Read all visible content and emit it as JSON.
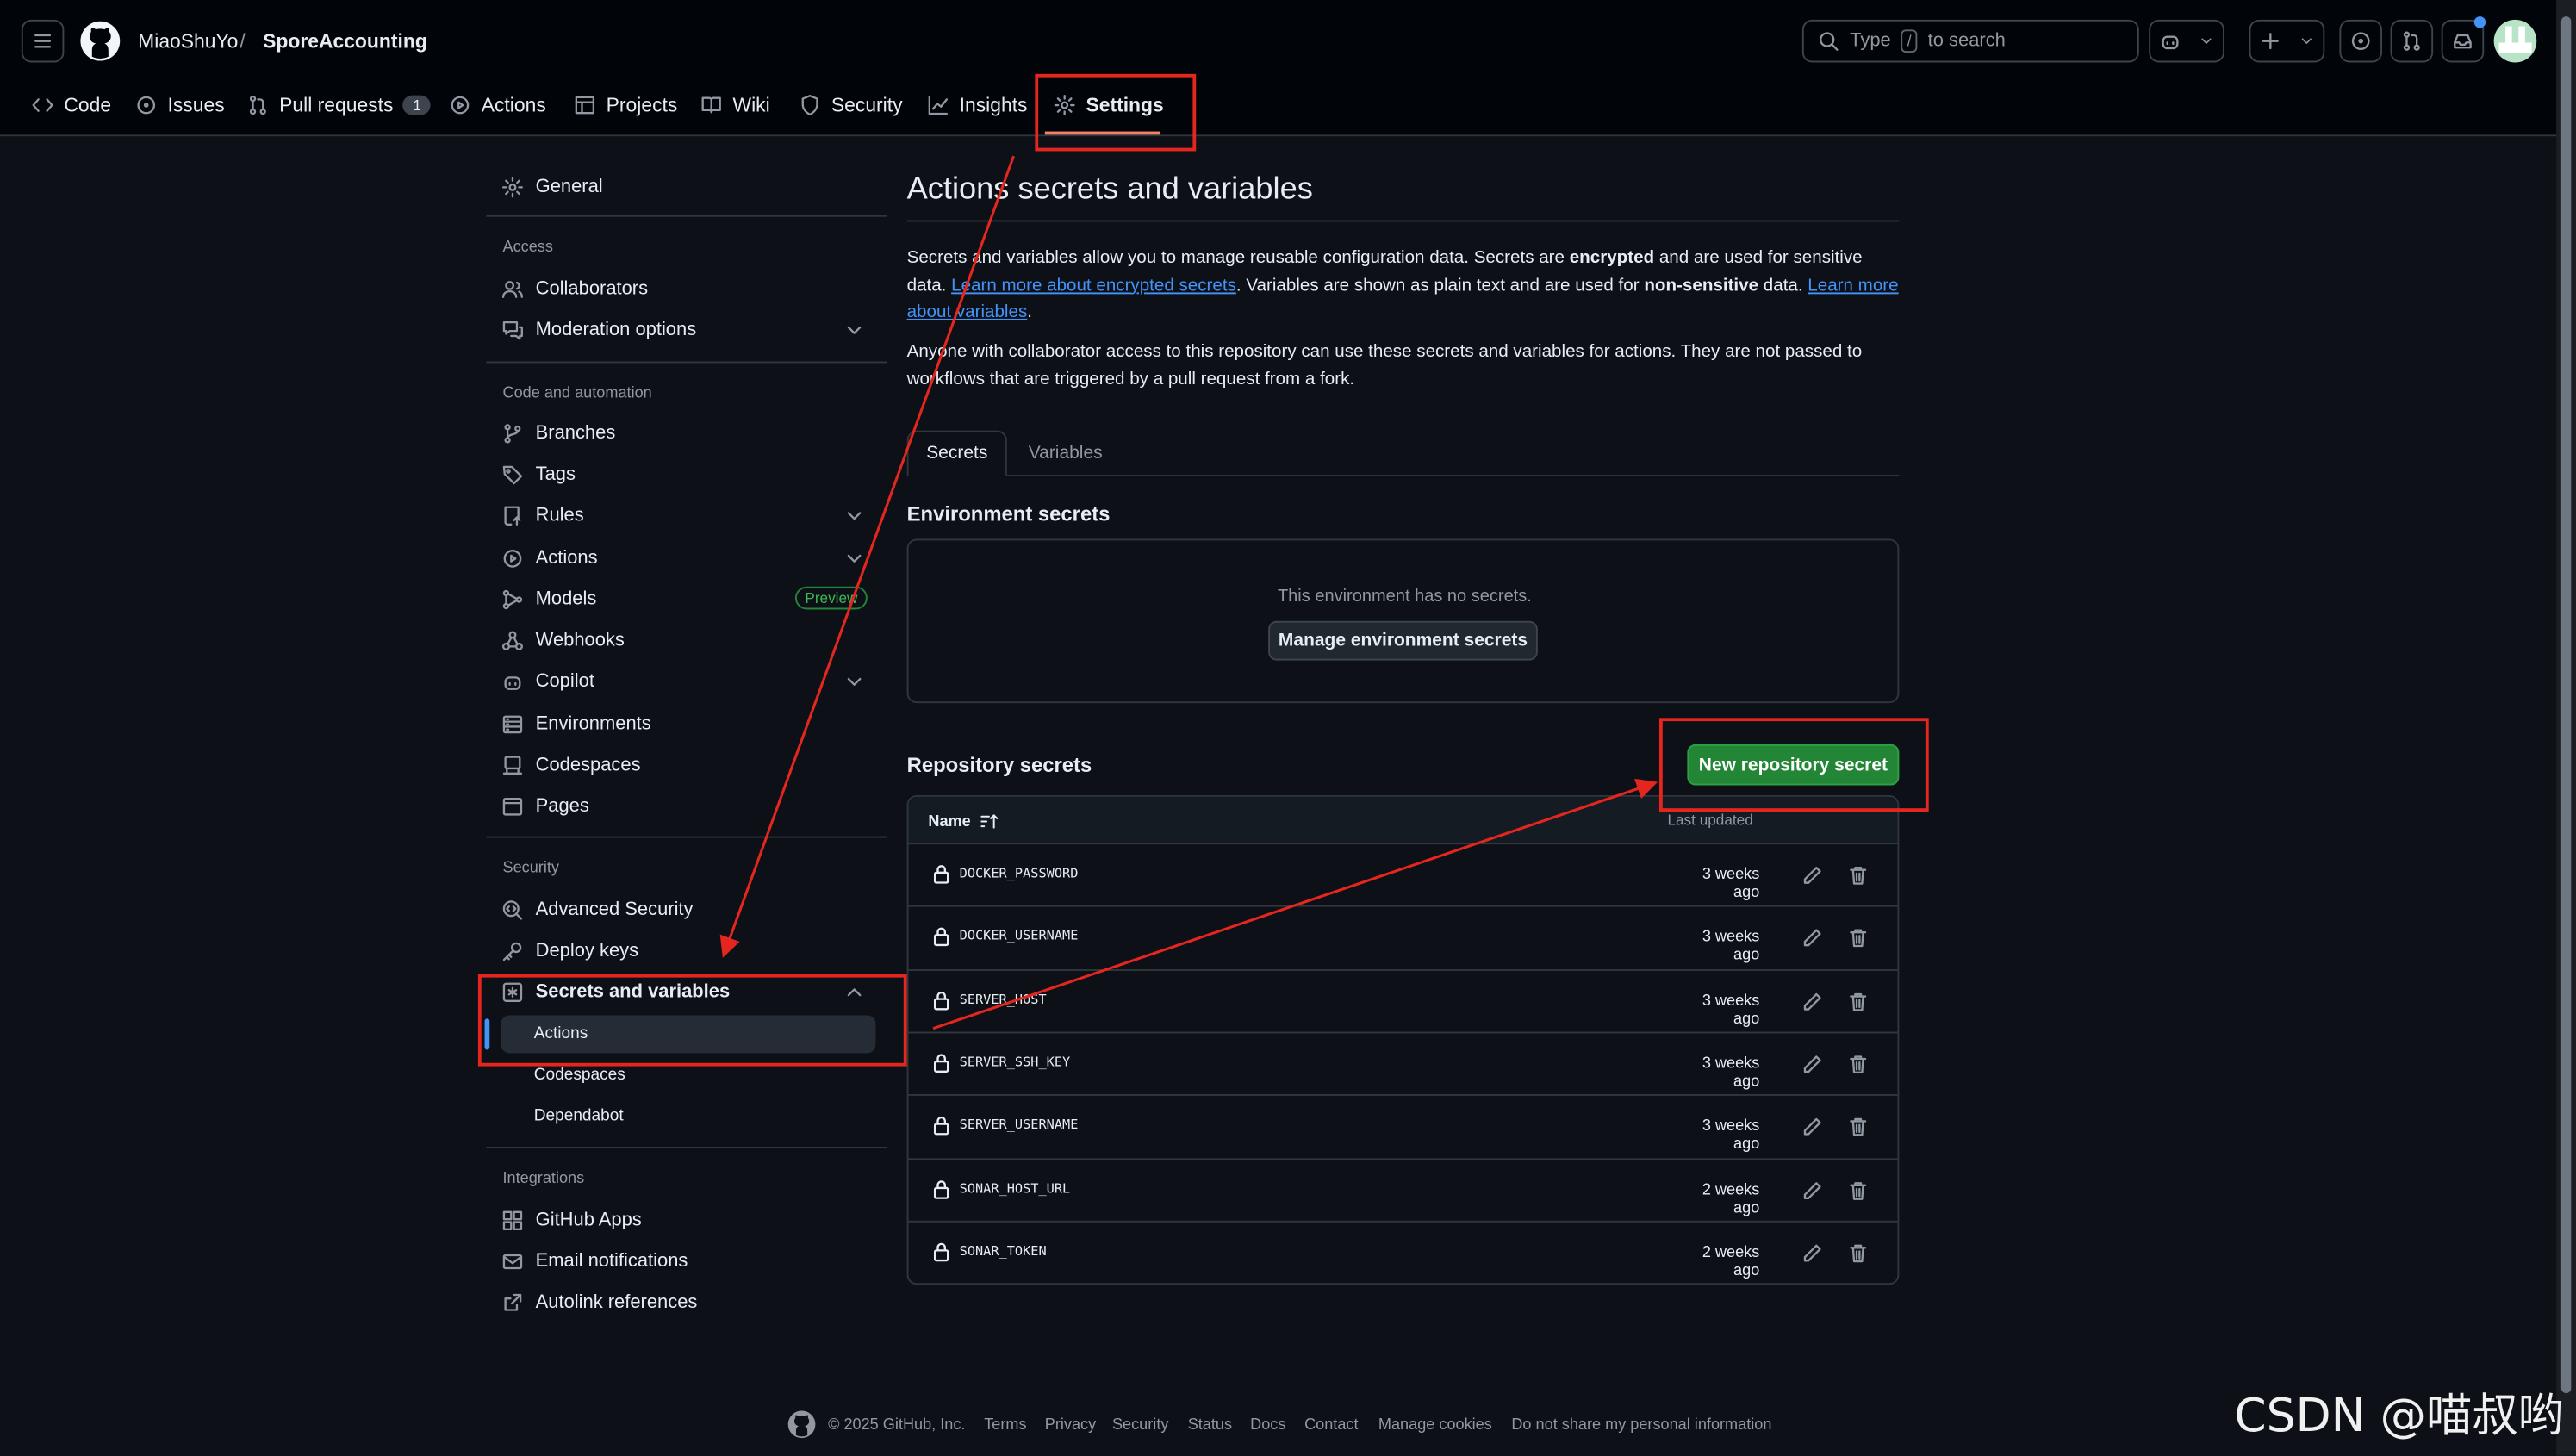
{
  "header": {
    "owner": "MiaoShuYo",
    "separator": "/",
    "repo": "SporeAccounting",
    "search_type": "Type",
    "search_key": "/",
    "search_rest": "to search"
  },
  "repo_tabs": [
    {
      "label": "Code"
    },
    {
      "label": "Issues"
    },
    {
      "label": "Pull requests",
      "count": "1"
    },
    {
      "label": "Actions"
    },
    {
      "label": "Projects"
    },
    {
      "label": "Wiki"
    },
    {
      "label": "Security"
    },
    {
      "label": "Insights"
    },
    {
      "label": "Settings"
    }
  ],
  "sidebar": {
    "general": "General",
    "access_heading": "Access",
    "access": [
      "Collaborators",
      "Moderation options"
    ],
    "code_heading": "Code and automation",
    "code": [
      "Branches",
      "Tags",
      "Rules",
      "Actions",
      "Models",
      "Webhooks",
      "Copilot",
      "Environments",
      "Codespaces",
      "Pages"
    ],
    "preview_badge": "Preview",
    "security_heading": "Security",
    "security": [
      "Advanced Security",
      "Deploy keys",
      "Secrets and variables"
    ],
    "secrets_sub": [
      "Actions",
      "Codespaces",
      "Dependabot"
    ],
    "integrations_heading": "Integrations",
    "integrations": [
      "GitHub Apps",
      "Email notifications",
      "Autolink references"
    ]
  },
  "main": {
    "title": "Actions secrets and variables",
    "intro": {
      "p1_a": "Secrets and variables allow you to manage reusable configuration data. Secrets are ",
      "p1_b": "encrypted",
      "p1_c": " and are used for sensitive data. ",
      "p1_link1": "Learn more about encrypted secrets",
      "p1_d": ". Variables are shown as plain text and are used for ",
      "p1_e": "non-sensitive",
      "p1_f": " data. ",
      "p1_link2": "Learn more about variables",
      "p1_g": ".",
      "p2": "Anyone with collaborator access to this repository can use these secrets and variables for actions. They are not passed to workflows that are triggered by a pull request from a fork."
    },
    "tabs": [
      "Secrets",
      "Variables"
    ],
    "env_heading": "Environment secrets",
    "env_empty": "This environment has no secrets.",
    "env_button": "Manage environment secrets",
    "repo_heading": "Repository secrets",
    "new_button": "New repository secret",
    "col_name": "Name",
    "col_updated": "Last updated",
    "secrets": [
      {
        "name": "DOCKER_PASSWORD",
        "updated": "3 weeks ago"
      },
      {
        "name": "DOCKER_USERNAME",
        "updated": "3 weeks ago"
      },
      {
        "name": "SERVER_HOST",
        "updated": "3 weeks ago"
      },
      {
        "name": "SERVER_SSH_KEY",
        "updated": "3 weeks ago"
      },
      {
        "name": "SERVER_USERNAME",
        "updated": "3 weeks ago"
      },
      {
        "name": "SONAR_HOST_URL",
        "updated": "2 weeks ago"
      },
      {
        "name": "SONAR_TOKEN",
        "updated": "2 weeks ago"
      }
    ]
  },
  "footer": [
    "© 2025 GitHub, Inc.",
    "Terms",
    "Privacy",
    "Security",
    "Status",
    "Docs",
    "Contact",
    "Manage cookies",
    "Do not share my personal information"
  ],
  "watermark": "CSDN @喵叔哟",
  "colors": {
    "accent_red": "#e5261f",
    "green_button": "#238636",
    "link": "#4493f8"
  }
}
